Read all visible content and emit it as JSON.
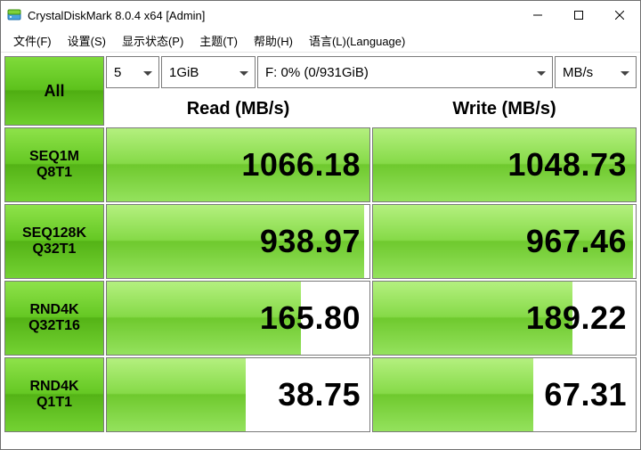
{
  "window": {
    "title": "CrystalDiskMark 8.0.4 x64 [Admin]"
  },
  "menu": {
    "file": "文件(F)",
    "settings": "设置(S)",
    "display": "显示状态(P)",
    "theme": "主题(T)",
    "help": "帮助(H)",
    "language": "语言(L)(Language)"
  },
  "controls": {
    "all_label": "All",
    "count": "5",
    "size": "1GiB",
    "drive": "F: 0% (0/931GiB)",
    "unit": "MB/s"
  },
  "headers": {
    "read": "Read (MB/s)",
    "write": "Write (MB/s)"
  },
  "tests": [
    {
      "line1": "SEQ1M",
      "line2": "Q8T1",
      "read": "1066.18",
      "read_pct": 100,
      "write": "1048.73",
      "write_pct": 100
    },
    {
      "line1": "SEQ128K",
      "line2": "Q32T1",
      "read": "938.97",
      "read_pct": 98,
      "write": "967.46",
      "write_pct": 99
    },
    {
      "line1": "RND4K",
      "line2": "Q32T16",
      "read": "165.80",
      "read_pct": 74,
      "write": "189.22",
      "write_pct": 76
    },
    {
      "line1": "RND4K",
      "line2": "Q1T1",
      "read": "38.75",
      "read_pct": 53,
      "write": "67.31",
      "write_pct": 61
    }
  ],
  "colors": {
    "green_grad_top": "#8ee24a",
    "green_grad_bot": "#74d233",
    "border": "#7a7a7a"
  }
}
